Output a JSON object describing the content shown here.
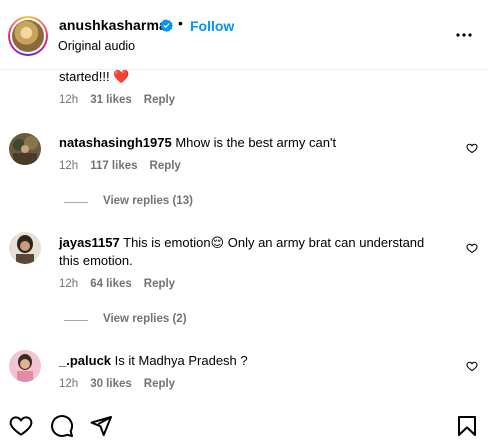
{
  "header": {
    "username": "anushkasharma",
    "separator": "•",
    "follow_label": "Follow",
    "audio_label": "Original audio"
  },
  "comments": [
    {
      "continuation_text": "started!!! ",
      "emoji": "❤️",
      "time": "12h",
      "likes": "31 likes",
      "reply": "Reply"
    },
    {
      "username": "natashasingh1975",
      "text": "Mhow is the best army can't",
      "time": "12h",
      "likes": "117 likes",
      "reply": "Reply",
      "view_replies": "View replies (13)"
    },
    {
      "username": "jayas1157",
      "text_line1": "This is emotion",
      "emoji": "😌",
      "text_line1b": " Only an army brat can understand",
      "text_line2": "this emotion.",
      "time": "12h",
      "likes": "64 likes",
      "reply": "Reply",
      "view_replies": "View replies (2)"
    },
    {
      "username": "_.paluck",
      "text": "Is it Madhya Pradesh ?",
      "time": "12h",
      "likes": "30 likes",
      "reply": "Reply"
    }
  ],
  "colors": {
    "accent": "#0095f6",
    "meta": "#737373",
    "heart": "#ed4956"
  },
  "icons": [
    "verified-badge-icon",
    "more-options-icon",
    "heart-icon",
    "comment-icon",
    "share-icon",
    "bookmark-icon"
  ]
}
